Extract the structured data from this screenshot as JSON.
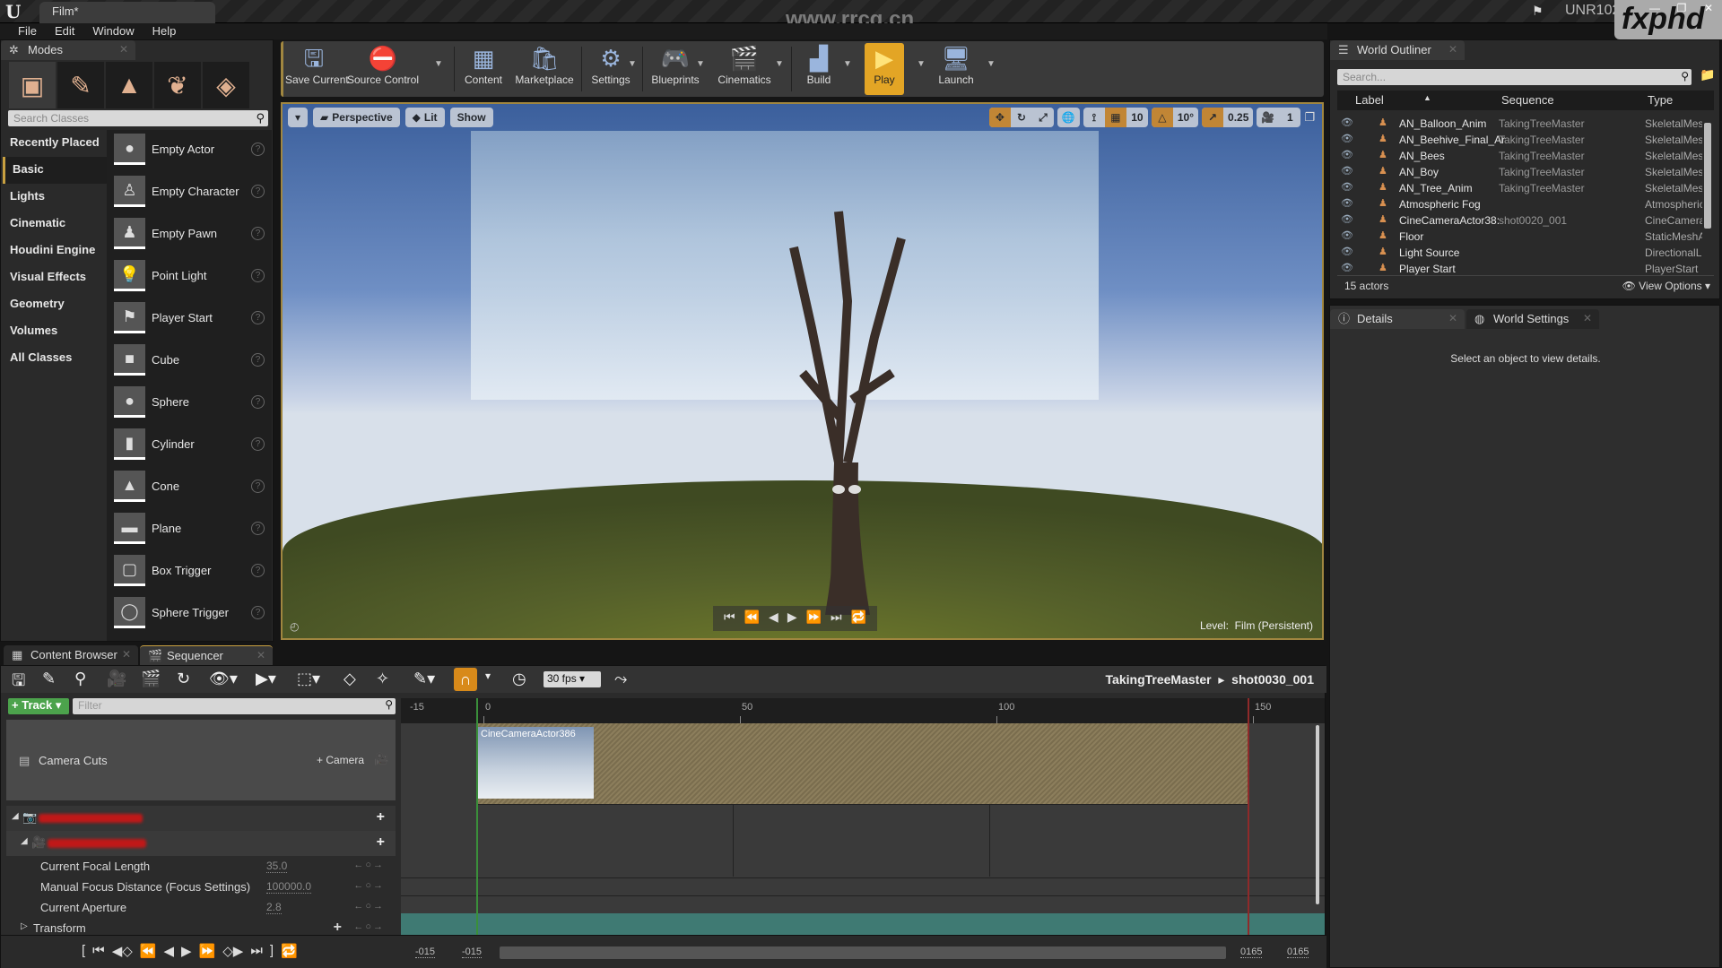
{
  "titlebar": {
    "doc_tab": "Film*",
    "watermark": "www.rrcg.cn",
    "project": "UNR102",
    "brand": "fxphd",
    "window_buttons": [
      "minimize",
      "maximize",
      "close"
    ]
  },
  "menu": [
    "File",
    "Edit",
    "Window",
    "Help"
  ],
  "modes": {
    "tab": "Modes",
    "mode_icons": [
      "place-mode-icon",
      "paint-mode-icon",
      "landscape-mode-icon",
      "foliage-mode-icon",
      "geometry-mode-icon"
    ],
    "search_placeholder": "Search Classes",
    "categories": [
      "Recently Placed",
      "Basic",
      "Lights",
      "Cinematic",
      "Houdini Engine",
      "Visual Effects",
      "Geometry",
      "Volumes",
      "All Classes"
    ],
    "active_category": "Basic",
    "classes": [
      "Empty Actor",
      "Empty Character",
      "Empty Pawn",
      "Point Light",
      "Player Start",
      "Cube",
      "Sphere",
      "Cylinder",
      "Cone",
      "Plane",
      "Box Trigger",
      "Sphere Trigger"
    ]
  },
  "toolbar": {
    "buttons": [
      {
        "label": "Save Current",
        "icon": "save-icon"
      },
      {
        "label": "Source Control",
        "icon": "source-control-icon"
      },
      {
        "label": "Content",
        "icon": "content-icon"
      },
      {
        "label": "Marketplace",
        "icon": "marketplace-icon"
      },
      {
        "label": "Settings",
        "icon": "settings-icon"
      },
      {
        "label": "Blueprints",
        "icon": "blueprints-icon"
      },
      {
        "label": "Cinematics",
        "icon": "cinematics-icon"
      },
      {
        "label": "Build",
        "icon": "build-icon"
      },
      {
        "label": "Play",
        "icon": "play-icon"
      },
      {
        "label": "Launch",
        "icon": "launch-icon"
      }
    ]
  },
  "viewport": {
    "view_mode": "Perspective",
    "lighting": "Lit",
    "show": "Show",
    "grid_snap": "10",
    "rotation_snap": "10°",
    "scale_snap": "0.25",
    "camera_speed": "1",
    "level_label": "Level:",
    "level_name": "Film (Persistent)"
  },
  "outliner": {
    "tab": "World Outliner",
    "search_placeholder": "Search...",
    "columns": [
      "Label",
      "Sequence",
      "Type"
    ],
    "rows": [
      {
        "label": "AN_Balloon_Anim",
        "sequence": "TakingTreeMaster",
        "type": "SkeletalMes"
      },
      {
        "label": "AN_Beehive_Final_Ar",
        "sequence": "TakingTreeMaster",
        "type": "SkeletalMes"
      },
      {
        "label": "AN_Bees",
        "sequence": "TakingTreeMaster",
        "type": "SkeletalMes"
      },
      {
        "label": "AN_Boy",
        "sequence": "TakingTreeMaster",
        "type": "SkeletalMes"
      },
      {
        "label": "AN_Tree_Anim",
        "sequence": "TakingTreeMaster",
        "type": "SkeletalMes"
      },
      {
        "label": "Atmospheric Fog",
        "sequence": "",
        "type": "Atmospheric"
      },
      {
        "label": "CineCameraActor38:",
        "sequence": "shot0020_001",
        "type": "CineCamera"
      },
      {
        "label": "Floor",
        "sequence": "",
        "type": "StaticMeshA"
      },
      {
        "label": "Light Source",
        "sequence": "",
        "type": "DirectionalL"
      },
      {
        "label": "Player Start",
        "sequence": "",
        "type": "PlayerStart"
      }
    ],
    "actor_count": "15 actors",
    "view_options": "View Options"
  },
  "details": {
    "tabs": [
      "Details",
      "World Settings"
    ],
    "empty_message": "Select an object to view details."
  },
  "bottom_tabs": [
    "Content Browser",
    "Sequencer"
  ],
  "sequencer": {
    "fps": "30 fps",
    "breadcrumb": [
      "TakingTreeMaster",
      "shot0030_001"
    ],
    "track_button": "Track",
    "filter_placeholder": "Filter",
    "camera_cuts": "Camera Cuts",
    "add_camera": "Camera",
    "properties": [
      {
        "name": "Current Focal Length",
        "value": "35.0"
      },
      {
        "name": "Manual Focus Distance (Focus Settings)",
        "value": "100000.0"
      },
      {
        "name": "Current Aperture",
        "value": "2.8"
      }
    ],
    "transform": "Transform",
    "ruler": {
      "start_label": "-15",
      "ticks": [
        "0",
        "50",
        "100",
        "150"
      ]
    },
    "shot_label": "CineCameraActor386",
    "range": {
      "view_start": "-015",
      "work_start": "-015",
      "view_end": "0165",
      "work_end": "0165"
    }
  }
}
